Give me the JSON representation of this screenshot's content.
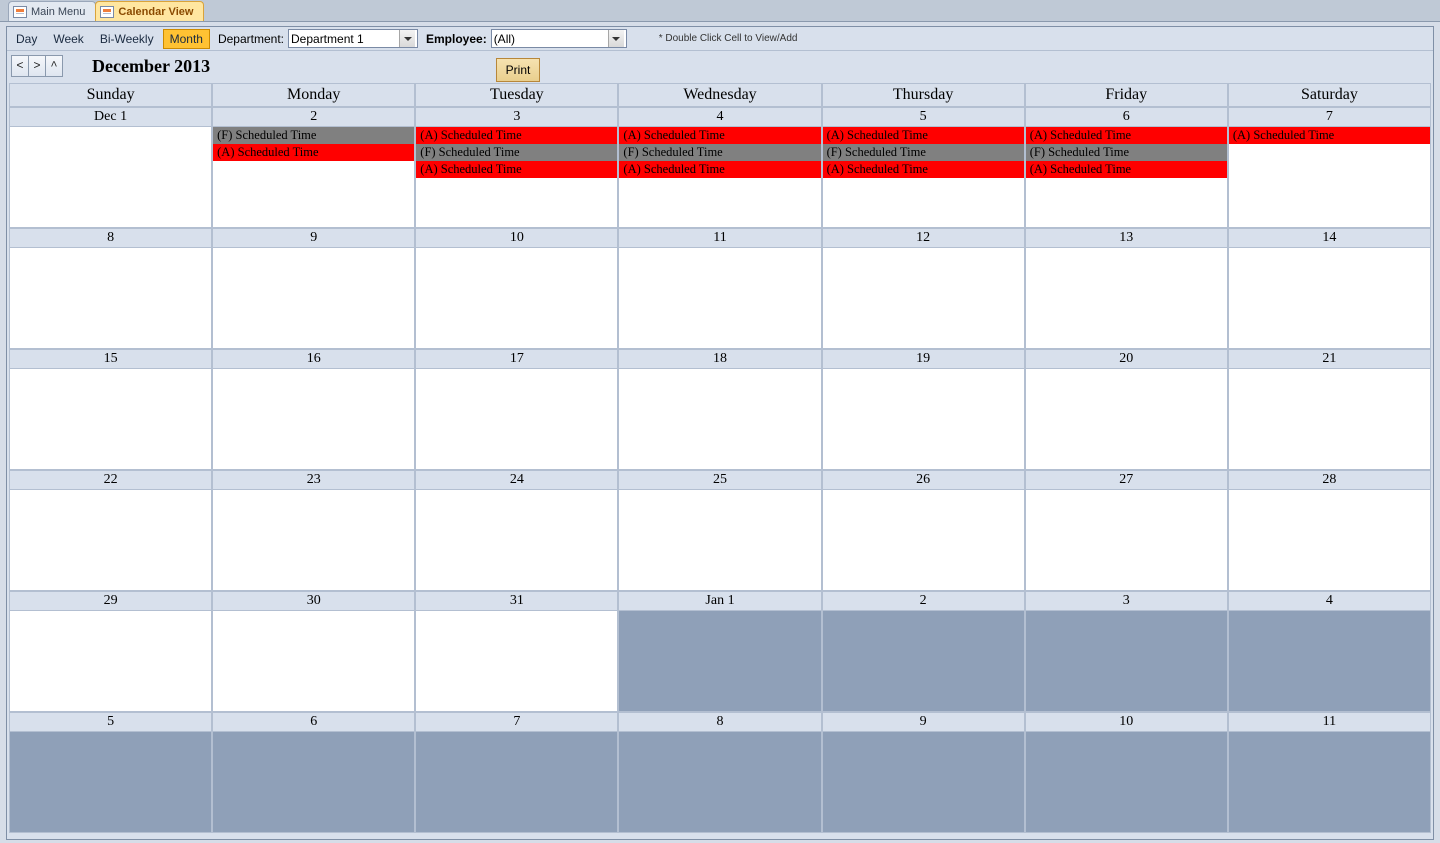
{
  "tabs": {
    "main": "Main Menu",
    "active": "Calendar View"
  },
  "toolbar": {
    "view_day": "Day",
    "view_week": "Week",
    "view_biweekly": "Bi-Weekly",
    "view_month": "Month",
    "dept_label": "Department:",
    "dept_value": "Department 1",
    "emp_label": "Employee:",
    "emp_value": "(All)",
    "hint": "* Double Click Cell to View/Add"
  },
  "nav": {
    "prev": "<",
    "next": ">",
    "up": "^",
    "title": "December 2013",
    "print": "Print"
  },
  "dow": [
    "Sunday",
    "Monday",
    "Tuesday",
    "Wednesday",
    "Thursday",
    "Friday",
    "Saturday"
  ],
  "weeks": [
    {
      "days": [
        {
          "label": "Dec 1",
          "out": false,
          "events": []
        },
        {
          "label": "2",
          "out": false,
          "events": [
            {
              "text": "(F) Scheduled Time",
              "cls": "gray"
            },
            {
              "text": "(A) Scheduled Time",
              "cls": "red"
            }
          ]
        },
        {
          "label": "3",
          "out": false,
          "events": [
            {
              "text": "(A) Scheduled Time",
              "cls": "red"
            },
            {
              "text": "(F) Scheduled Time",
              "cls": "gray"
            },
            {
              "text": "(A) Scheduled Time",
              "cls": "red"
            }
          ]
        },
        {
          "label": "4",
          "out": false,
          "events": [
            {
              "text": "(A) Scheduled Time",
              "cls": "red"
            },
            {
              "text": "(F) Scheduled Time",
              "cls": "gray"
            },
            {
              "text": "(A) Scheduled Time",
              "cls": "red"
            }
          ]
        },
        {
          "label": "5",
          "out": false,
          "events": [
            {
              "text": "(A) Scheduled Time",
              "cls": "red"
            },
            {
              "text": "(F) Scheduled Time",
              "cls": "gray"
            },
            {
              "text": "(A) Scheduled Time",
              "cls": "red"
            }
          ]
        },
        {
          "label": "6",
          "out": false,
          "events": [
            {
              "text": "(A) Scheduled Time",
              "cls": "red"
            },
            {
              "text": "(F) Scheduled Time",
              "cls": "gray"
            },
            {
              "text": "(A) Scheduled Time",
              "cls": "red"
            }
          ]
        },
        {
          "label": "7",
          "out": false,
          "events": [
            {
              "text": "(A) Scheduled Time",
              "cls": "red"
            }
          ]
        }
      ]
    },
    {
      "days": [
        {
          "label": "8",
          "out": false,
          "events": []
        },
        {
          "label": "9",
          "out": false,
          "events": []
        },
        {
          "label": "10",
          "out": false,
          "events": []
        },
        {
          "label": "11",
          "out": false,
          "events": []
        },
        {
          "label": "12",
          "out": false,
          "events": []
        },
        {
          "label": "13",
          "out": false,
          "events": []
        },
        {
          "label": "14",
          "out": false,
          "events": []
        }
      ]
    },
    {
      "days": [
        {
          "label": "15",
          "out": false,
          "events": []
        },
        {
          "label": "16",
          "out": false,
          "events": []
        },
        {
          "label": "17",
          "out": false,
          "events": []
        },
        {
          "label": "18",
          "out": false,
          "events": []
        },
        {
          "label": "19",
          "out": false,
          "events": []
        },
        {
          "label": "20",
          "out": false,
          "events": []
        },
        {
          "label": "21",
          "out": false,
          "events": []
        }
      ]
    },
    {
      "days": [
        {
          "label": "22",
          "out": false,
          "events": []
        },
        {
          "label": "23",
          "out": false,
          "events": []
        },
        {
          "label": "24",
          "out": false,
          "events": []
        },
        {
          "label": "25",
          "out": false,
          "events": []
        },
        {
          "label": "26",
          "out": false,
          "events": []
        },
        {
          "label": "27",
          "out": false,
          "events": []
        },
        {
          "label": "28",
          "out": false,
          "events": []
        }
      ]
    },
    {
      "days": [
        {
          "label": "29",
          "out": false,
          "events": []
        },
        {
          "label": "30",
          "out": false,
          "events": []
        },
        {
          "label": "31",
          "out": false,
          "events": []
        },
        {
          "label": "Jan 1",
          "out": true,
          "events": []
        },
        {
          "label": "2",
          "out": true,
          "events": []
        },
        {
          "label": "3",
          "out": true,
          "events": []
        },
        {
          "label": "4",
          "out": true,
          "events": []
        }
      ]
    },
    {
      "days": [
        {
          "label": "5",
          "out": true,
          "events": []
        },
        {
          "label": "6",
          "out": true,
          "events": []
        },
        {
          "label": "7",
          "out": true,
          "events": []
        },
        {
          "label": "8",
          "out": true,
          "events": []
        },
        {
          "label": "9",
          "out": true,
          "events": []
        },
        {
          "label": "10",
          "out": true,
          "events": []
        },
        {
          "label": "11",
          "out": true,
          "events": []
        }
      ]
    }
  ]
}
